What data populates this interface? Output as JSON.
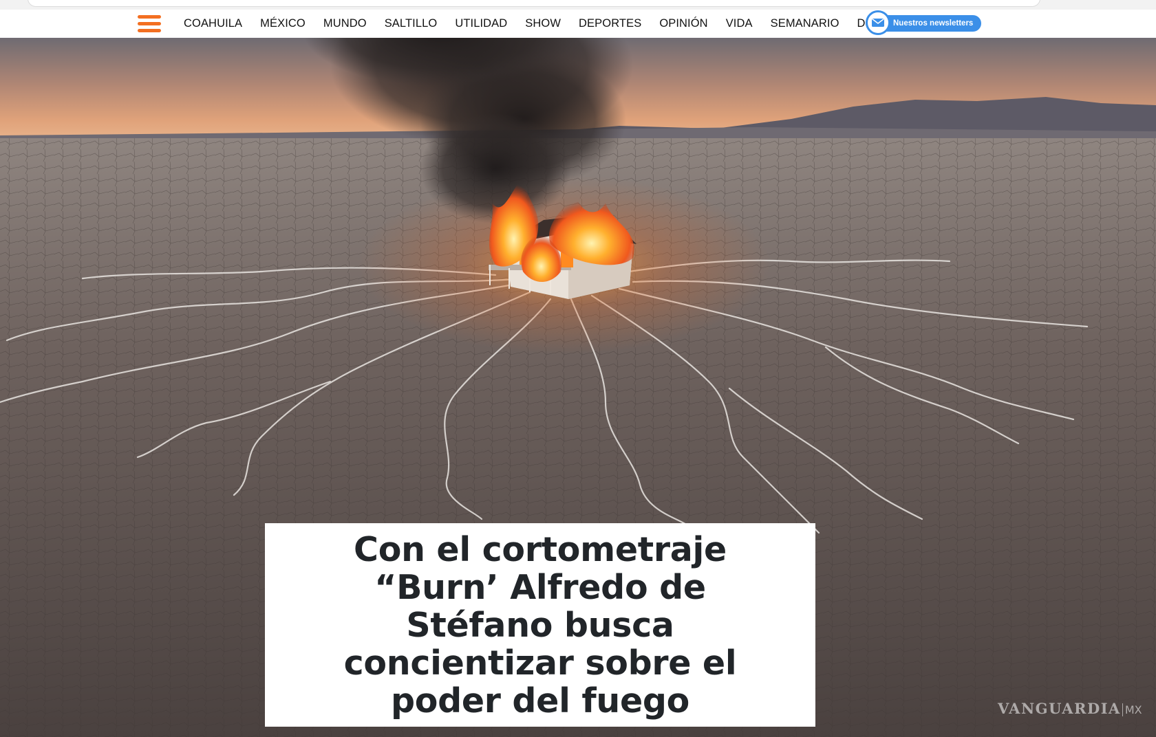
{
  "nav": {
    "items": [
      "COAHUILA",
      "MÉXICO",
      "MUNDO",
      "SALTILLO",
      "UTILIDAD",
      "SHOW",
      "DEPORTES",
      "OPINIÓN",
      "VIDA",
      "SEMANARIO",
      "DINER"
    ],
    "newsletter_label": "Nuestros newsletters",
    "menu_icon": "hamburger-menu-icon",
    "newsletter_icon": "envelope-icon"
  },
  "article": {
    "headline": "Con el cortometraje “Burn’ Alfredo de Stéfano busca concientizar sobre el poder del fuego"
  },
  "watermark": {
    "brand": "VANGUARDIA",
    "suffix": "MX"
  },
  "colors": {
    "accent": "#f36f21",
    "newsletter": "#3b8fe8",
    "headline_text": "#212529"
  }
}
